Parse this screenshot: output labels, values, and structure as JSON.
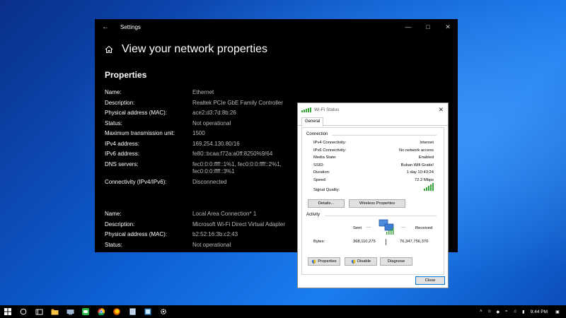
{
  "settings": {
    "title": "Settings",
    "page_title": "View your network properties",
    "section_title": "Properties",
    "adapter1": [
      {
        "name": "Name:",
        "value": "Ethernet"
      },
      {
        "name": "Description:",
        "value": "Realtek PCIe GbE Family Controller"
      },
      {
        "name": "Physical address (MAC):",
        "value": "ace2:d3:7d:8b:26"
      },
      {
        "name": "Status:",
        "value": "Not operational"
      },
      {
        "name": "Maximum transmission unit:",
        "value": "1500"
      },
      {
        "name": "IPv4 address:",
        "value": "169.254.130.80/16"
      },
      {
        "name": "IPv6 address:",
        "value": "fe80::bcaa:f72a:a0ff:8250%9/64"
      },
      {
        "name": "DNS servers:",
        "value": "fec0:0:0:ffff::1%1, fec0:0:0:ffff::2%1,",
        "value2": "fec0:0:0:ffff::3%1"
      },
      {
        "name": "Connectivity (IPv4/IPv6):",
        "value": "Disconnected"
      }
    ],
    "adapter2": [
      {
        "name": "Name:",
        "value": "Local Area Connection* 1"
      },
      {
        "name": "Description:",
        "value": "Microsoft Wi-Fi Direct Virtual Adapter"
      },
      {
        "name": "Physical address (MAC):",
        "value": "b2:52:16:3b:c2:43"
      },
      {
        "name": "Status:",
        "value": "Not operational"
      }
    ]
  },
  "wifi": {
    "title": "Wi-Fi Status",
    "tab": "General",
    "connection_title": "Connection",
    "connection": [
      {
        "k": "IPv4 Connectivity:",
        "v": "Internet"
      },
      {
        "k": "IPv6 Connectivity:",
        "v": "No network access"
      },
      {
        "k": "Media State:",
        "v": "Enabled"
      },
      {
        "k": "SSID:",
        "v": "Bukan Wifi Gratis!"
      },
      {
        "k": "Duration:",
        "v": "1 day 10:43:24"
      },
      {
        "k": "Speed:",
        "v": "72.2 Mbps"
      }
    ],
    "signal_label": "Signal Quality:",
    "signal_level": 1.0,
    "details_btn": "Details...",
    "wireless_btn": "Wireless Properties",
    "activity_title": "Activity",
    "sent_label": "Sent",
    "received_label": "Received",
    "bytes_label": "Bytes:",
    "bytes_sent": "368,110,275",
    "bytes_received": "76,347,756,370",
    "properties_btn": "Properties",
    "disable_btn": "Disable",
    "diagnose_btn": "Diagnose",
    "close_btn": "Close"
  },
  "taskbar": {
    "time": "9:44 PM",
    "icons": [
      "windows-start-icon",
      "search-icon",
      "task-view-icon",
      "file-explorer-icon",
      "network-folder-icon",
      "line-app-icon",
      "chrome-icon",
      "firefox-icon",
      "notepad-icon",
      "app-icon",
      "settings-icon"
    ]
  }
}
